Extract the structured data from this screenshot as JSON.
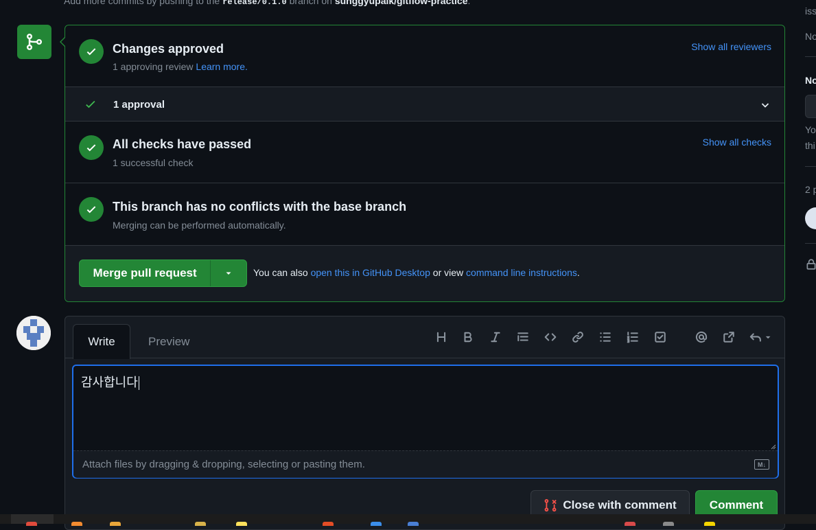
{
  "top_line": {
    "prefix": "Add more commits by pushing to the",
    "branch": "release/0.1.0",
    "middle": "branch on",
    "repo": "sunggyupaik/gitflow-practice",
    "suffix": "."
  },
  "merge_box": {
    "approved": {
      "title": "Changes approved",
      "subtitle": "1 approving review",
      "learn_more": "Learn more.",
      "link": "Show all reviewers"
    },
    "approval_row": {
      "label": "1 approval"
    },
    "checks": {
      "title": "All checks have passed",
      "subtitle": "1 successful check",
      "link": "Show all checks"
    },
    "conflicts": {
      "title": "This branch has no conflicts with the base branch",
      "subtitle": "Merging can be performed automatically."
    },
    "merge_button": "Merge pull request",
    "note": {
      "prefix": "You can also",
      "desktop_link": "open this in GitHub Desktop",
      "middle": "or view",
      "cli_link": "command line instructions",
      "suffix": "."
    }
  },
  "comment": {
    "tabs": {
      "write": "Write",
      "preview": "Preview"
    },
    "toolbar_icons": [
      "heading-icon",
      "bold-icon",
      "italic-icon",
      "quote-icon",
      "code-icon",
      "link-icon",
      "bullet-list-icon",
      "numbered-list-icon",
      "task-list-icon",
      "mention-icon",
      "reference-icon",
      "reply-icon"
    ],
    "text": "감사합니다",
    "attach_hint": "Attach files by dragging & dropping, selecting or pasting them.",
    "markdown_badge": "M↓",
    "close_button": "Close with comment",
    "comment_button": "Comment"
  },
  "sidebar": {
    "fragments": [
      "iss",
      "No",
      "No",
      "Yo",
      "thi",
      "2 p"
    ]
  },
  "colors": {
    "background": "#0d1117",
    "success": "#238636",
    "link": "#4493f8",
    "focus": "#1f6feb",
    "close_icon": "#f85149"
  }
}
